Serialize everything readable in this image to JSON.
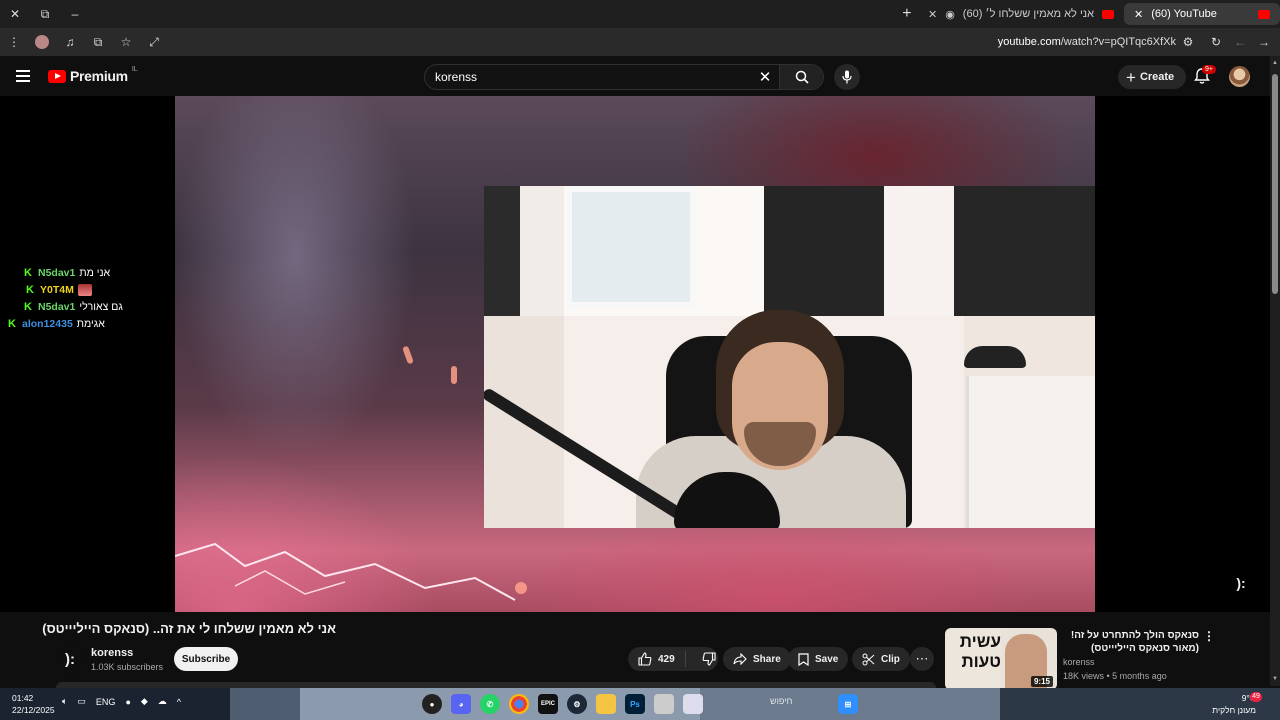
{
  "browser": {
    "tabs": [
      {
        "title": "(60) YouTube",
        "active": true
      },
      {
        "title": "(60) אני לא מאמין ששלחו ל׳",
        "active": false
      }
    ],
    "url_domain": "youtube.com",
    "url_path": "/watch?v=pQITqc6XfXk"
  },
  "masthead": {
    "logo_text": "Premium",
    "logo_region": "IL",
    "search_value": "korenss",
    "search_placeholder": "Search",
    "create_label": "Create",
    "notifications_badge": "9+"
  },
  "chat": [
    {
      "user": "N5dav1",
      "message": "אני מת",
      "color": "#6ad66a"
    },
    {
      "user": "Y0T4M",
      "message": "",
      "emote": true,
      "color": "#f2d21b"
    },
    {
      "user": "N5dav1",
      "message": "גם צאורלי",
      "color": "#6ad66a"
    },
    {
      "user": "alon12435",
      "message": "אגימת",
      "color": "#3d8fe0"
    }
  ],
  "overlay_button": "):",
  "video": {
    "title": "אני לא מאמין ששלחו לי את זה.. (סנאקס הייליייטס)",
    "channel_avatar_text": "):",
    "channel_name": "korenss",
    "subscribers": "1.03K subscribers",
    "subscribe_label": "Subscribe",
    "likes": "429",
    "share_label": "Share",
    "save_label": "Save",
    "clip_label": "Clip",
    "more_label": "⋯"
  },
  "recommended": {
    "thumb_text": "עשית טעות",
    "duration": "9:15",
    "title": "סנאקס הולך להתחרט על זה! (מאור סנאקס הייליייטס)",
    "channel": "korenss",
    "meta": "18K views • 5 months ago"
  },
  "taskbar": {
    "time": "01:42",
    "date": "22/12/2025",
    "lang": "ENG",
    "search_text": "חיפוש",
    "weather_temp": "9°C",
    "weather_desc": "מעונן חלקית",
    "weather_badge": "49"
  },
  "colors": {
    "youtube_red": "#ff0000",
    "kick_green": "#53fc18",
    "background": "#0f0f0f"
  }
}
